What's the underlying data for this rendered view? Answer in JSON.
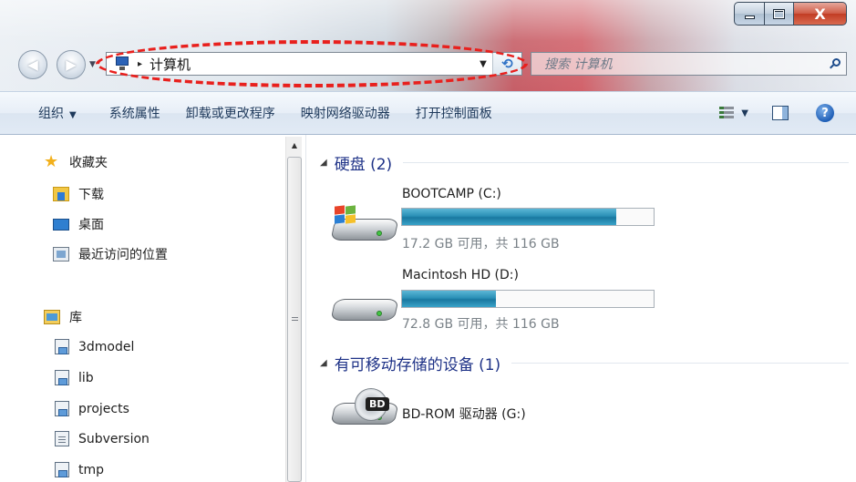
{
  "window": {
    "minimize_glyph": "minimize",
    "maximize_glyph": "maximize",
    "close_glyph": "X"
  },
  "address": {
    "location": "计算机",
    "breadcrumb_separator": "▸",
    "dropdown_glyph": "▼",
    "refresh_glyph": "⟲"
  },
  "search": {
    "placeholder": "搜索 计算机"
  },
  "toolbar": {
    "organize": "组织",
    "organize_caret": "▼",
    "system_properties": "系统属性",
    "uninstall": "卸载或更改程序",
    "map_drive": "映射网络驱动器",
    "control_panel": "打开控制面板",
    "views_caret": "▼",
    "help_glyph": "?"
  },
  "sidebar": {
    "favorites": {
      "label": "收藏夹",
      "items": [
        {
          "label": "下载",
          "icon": "download-folder-icon"
        },
        {
          "label": "桌面",
          "icon": "desktop-icon"
        },
        {
          "label": "最近访问的位置",
          "icon": "recent-places-icon"
        }
      ]
    },
    "libraries": {
      "label": "库",
      "items": [
        {
          "label": "3dmodel",
          "icon": "library-folder-icon"
        },
        {
          "label": "lib",
          "icon": "library-folder-icon"
        },
        {
          "label": "projects",
          "icon": "library-folder-icon"
        },
        {
          "label": "Subversion",
          "icon": "library-documents-icon"
        },
        {
          "label": "tmp",
          "icon": "library-folder-icon"
        }
      ]
    }
  },
  "content": {
    "groups": [
      {
        "title": "硬盘 (2)",
        "drives": [
          {
            "name": "BOOTCAMP (C:)",
            "free_text": "17.2 GB 可用，共 116 GB",
            "used_fraction": 0.852,
            "icon": "system-drive-icon"
          },
          {
            "name": "Macintosh HD (D:)",
            "free_text": "72.8 GB 可用，共 116 GB",
            "used_fraction": 0.372,
            "icon": "hard-drive-icon"
          }
        ]
      },
      {
        "title": "有可移动存储的设备 (1)",
        "drives": [
          {
            "name": "BD-ROM 驱动器 (G:)",
            "badge": "BD",
            "icon": "bd-rom-drive-icon"
          }
        ]
      }
    ]
  },
  "colors": {
    "annotation_dashes": "#e8201d",
    "usage_bar": "#2a8fb6",
    "group_title": "#1e3287",
    "toolbar_text": "#1e395b"
  }
}
